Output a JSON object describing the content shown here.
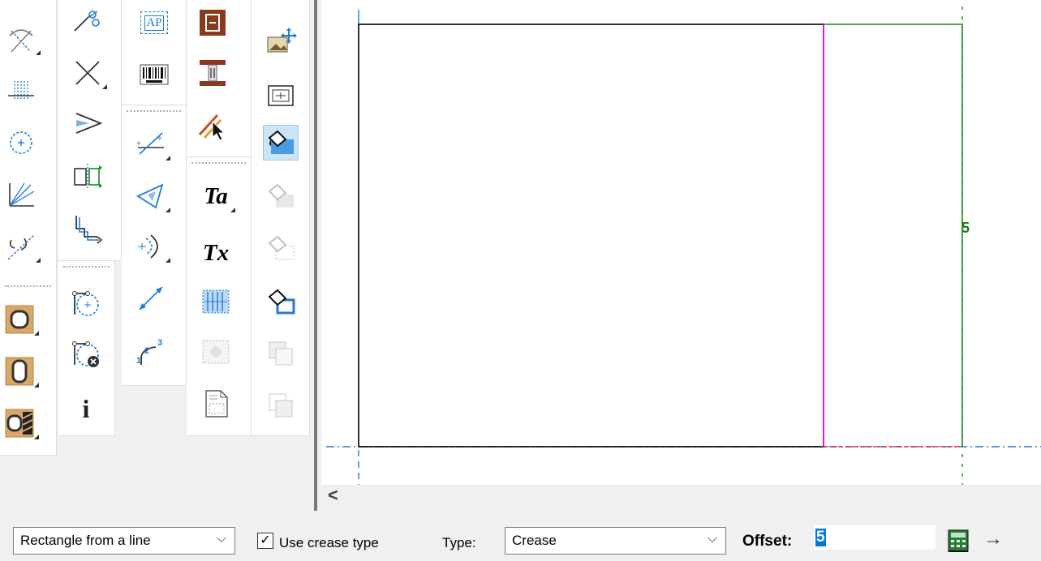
{
  "canvas": {
    "dimension_label": "5",
    "colors": {
      "outline": "#000000",
      "crease_line": "#ff00ff",
      "offset_line": "#1a8a1a",
      "axis": "#1e7bd8",
      "cut_marker": "#ff0000",
      "dimension": "#1a7a1a"
    }
  },
  "toolbar": {
    "icons": [
      "arc-tool-icon",
      "grid-line-icon",
      "circle-center-icon",
      "radial-lines-icon",
      "fillet-tool-icon",
      "scissors-trim-icon",
      "cross-delete-icon",
      "chevron-arrow-icon",
      "mirror-split-icon",
      "step-path-icon",
      "circle-through-points-icon",
      "circle-delete-icon",
      "info-icon",
      "ap-text-icon",
      "barcode-icon",
      "tangent-line-icon",
      "angle-triangle-icon",
      "arc-offset-icon",
      "dimension-line-icon",
      "numbered-path-icon",
      "box-panel-icon",
      "i-beam-clip-icon",
      "select-pointer-icon",
      "text-ta-icon",
      "text-tx-icon",
      "hatch-fill-icon",
      "dotted-fill-icon",
      "document-icon",
      "move-image-icon",
      "frame-image-icon",
      "paint-bucket-icon",
      "paint-bucket-shadow-icon",
      "paint-bucket-frame-icon",
      "paint-bucket-blue-icon",
      "layer-copy-icon",
      "layer-stack-icon",
      "finish-round-icon",
      "finish-tall-icon",
      "finish-hatched-icon"
    ],
    "text_tool_ta": "Ta",
    "text_tool_tx": "Tx",
    "ap_label": "AP",
    "info_glyph": "i"
  },
  "scrollbar": {
    "left_arrow": "<"
  },
  "statusbar": {
    "mode_select": "Rectangle from a line",
    "use_crease_label": "Use crease type",
    "use_crease_checked": "✓",
    "type_label": "Type:",
    "type_select": "Crease",
    "offset_label": "Offset:",
    "offset_value": "5",
    "chevron": "⌵",
    "apply_arrow": "→"
  }
}
